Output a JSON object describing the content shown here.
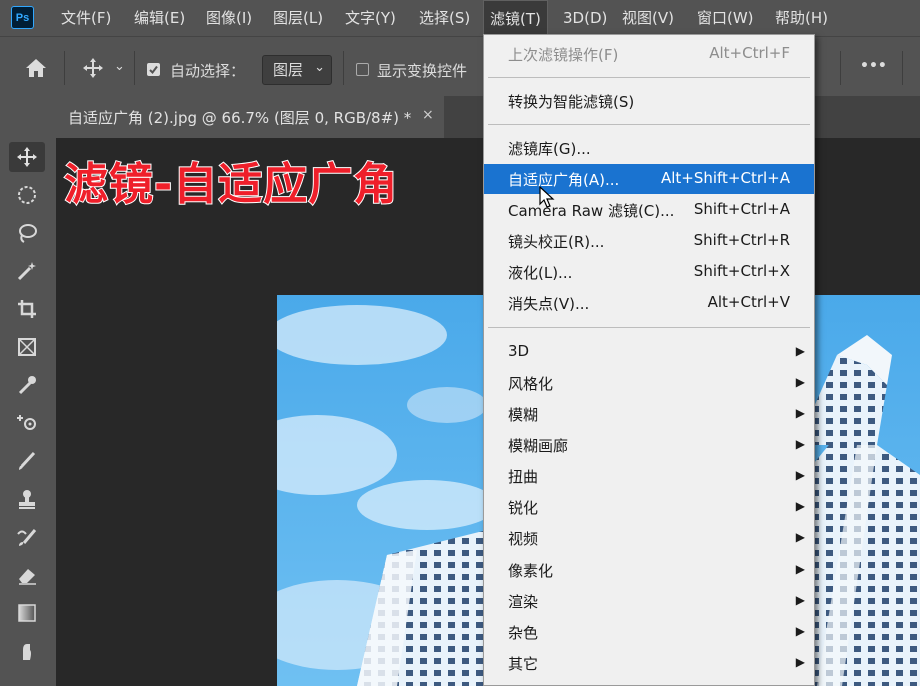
{
  "menubar": {
    "logo": "Ps",
    "items": [
      "文件(F)",
      "编辑(E)",
      "图像(I)",
      "图层(L)",
      "文字(Y)",
      "选择(S)",
      "滤镜(T)",
      "3D(D)",
      "视图(V)",
      "窗口(W)",
      "帮助(H)"
    ],
    "active_index": 6
  },
  "options": {
    "auto_select_label": "自动选择：",
    "auto_select_checked": true,
    "layer_select_value": "图层",
    "show_transform_label": "显示变换控件",
    "more": "•••"
  },
  "tab": {
    "title": "自适应广角 (2).jpg @ 66.7% (图层 0, RGB/8#) *",
    "close": "×"
  },
  "overlay": {
    "title": "滤镜-自适应广角",
    "color": "#ef1f2a"
  },
  "filter_menu": {
    "items": [
      {
        "label": "上次滤镜操作(F)",
        "shortcut": "Alt+Ctrl+F",
        "disabled": true
      },
      {
        "label": "转换为智能滤镜(S)",
        "shortcut": ""
      },
      {
        "label": "滤镜库(G)...",
        "shortcut": ""
      },
      {
        "label": "自适应广角(A)...",
        "shortcut": "Alt+Shift+Ctrl+A",
        "highlighted": true
      },
      {
        "label": "Camera Raw 滤镜(C)...",
        "shortcut": "Shift+Ctrl+A"
      },
      {
        "label": "镜头校正(R)...",
        "shortcut": "Shift+Ctrl+R"
      },
      {
        "label": "液化(L)...",
        "shortcut": "Shift+Ctrl+X"
      },
      {
        "label": "消失点(V)...",
        "shortcut": "Alt+Ctrl+V"
      },
      {
        "label": "3D",
        "submenu": true
      },
      {
        "label": "风格化",
        "submenu": true
      },
      {
        "label": "模糊",
        "submenu": true
      },
      {
        "label": "模糊画廊",
        "submenu": true
      },
      {
        "label": "扭曲",
        "submenu": true
      },
      {
        "label": "锐化",
        "submenu": true
      },
      {
        "label": "视频",
        "submenu": true
      },
      {
        "label": "像素化",
        "submenu": true
      },
      {
        "label": "渲染",
        "submenu": true
      },
      {
        "label": "杂色",
        "submenu": true
      },
      {
        "label": "其它",
        "submenu": true
      }
    ],
    "highlight_color": "#1a73d0"
  },
  "tools": [
    "move-tool-icon",
    "marquee-tool-icon",
    "lasso-tool-icon",
    "magic-wand-icon",
    "crop-tool-icon",
    "frame-tool-icon",
    "eyedropper-icon",
    "healing-brush-icon",
    "brush-tool-icon",
    "clone-stamp-icon",
    "history-brush-icon",
    "eraser-icon",
    "gradient-tool-icon",
    "smudge-tool-icon"
  ]
}
